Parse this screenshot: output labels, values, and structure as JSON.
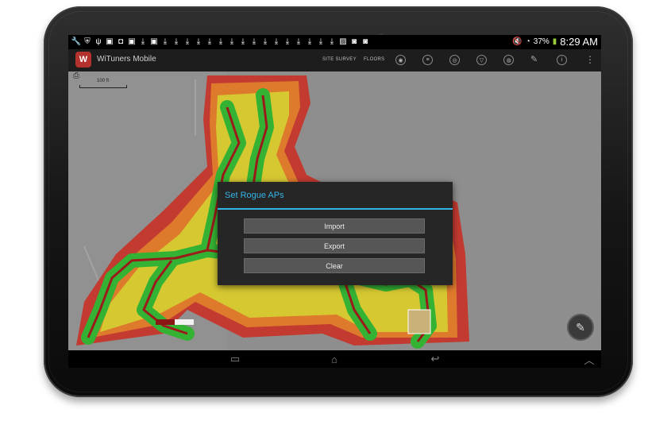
{
  "statusbar": {
    "notification_icons": [
      "wrench-icon",
      "shield-icon",
      "usb-icon",
      "sd-icon",
      "screenshot-icon",
      "sd-icon",
      "download-icon",
      "sd-icon",
      "download-icon",
      "download-icon",
      "download-icon",
      "download-icon",
      "download-icon",
      "download-icon",
      "download-icon",
      "download-icon",
      "download-icon",
      "download-icon",
      "download-icon",
      "download-icon",
      "download-icon",
      "download-icon",
      "download-icon",
      "download-icon",
      "image-icon",
      "bag-icon",
      "bag-icon"
    ],
    "battery": "37%",
    "time": "8:29 AM"
  },
  "actionbar": {
    "app_title": "WiTuners Mobile",
    "site_survey": "SITE SURVEY",
    "floors": "FLOORS"
  },
  "map": {
    "scale_label": "100 ft"
  },
  "dialog": {
    "title": "Set Rogue APs",
    "buttons": [
      "Import",
      "Export",
      "Clear"
    ]
  },
  "colors": {
    "accent": "#32b5e5",
    "heat_red": "#c62a2a",
    "heat_orange": "#e0772e",
    "heat_yellow": "#d9cc2e",
    "heat_green": "#2fae2f",
    "path_red": "#9b1a1a"
  }
}
